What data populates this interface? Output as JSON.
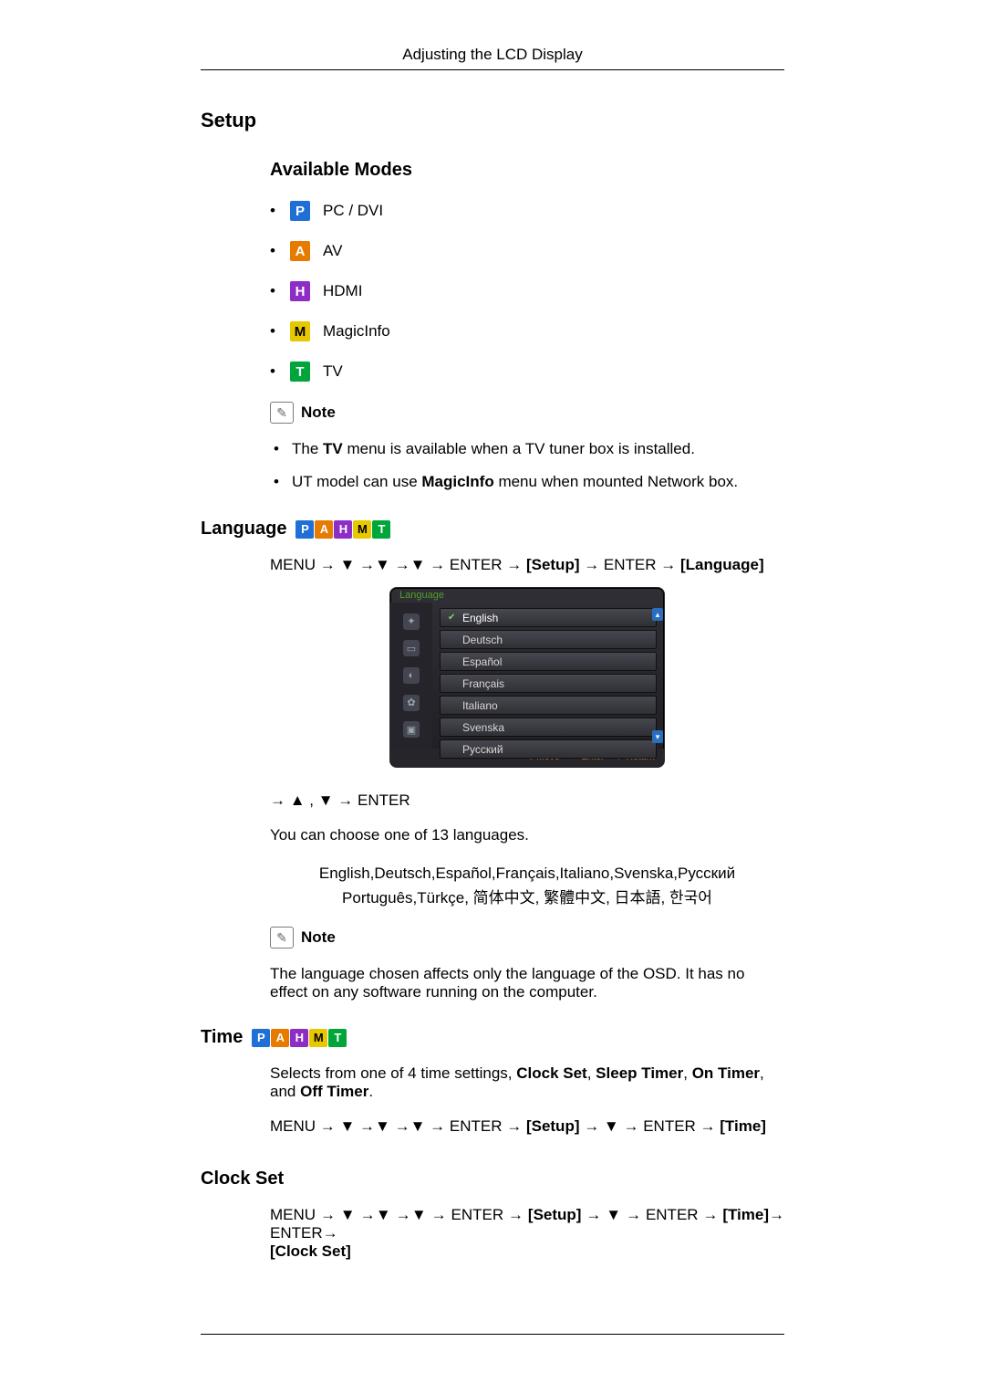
{
  "header": {
    "title": "Adjusting the LCD Display"
  },
  "setup": {
    "heading": "Setup",
    "availableModes": {
      "heading": "Available Modes",
      "items": [
        {
          "chip": "P",
          "chipClass": "chip-p",
          "label": "PC / DVI"
        },
        {
          "chip": "A",
          "chipClass": "chip-a",
          "label": "AV"
        },
        {
          "chip": "H",
          "chipClass": "chip-h",
          "label": "HDMI"
        },
        {
          "chip": "M",
          "chipClass": "chip-m",
          "label": "MagicInfo"
        },
        {
          "chip": "T",
          "chipClass": "chip-t",
          "label": "TV"
        }
      ]
    },
    "note": {
      "label": "Note",
      "items": [
        {
          "before": "The ",
          "bold": "TV",
          "after": " menu is available when a TV tuner box is installed."
        },
        {
          "before": "UT model can use ",
          "bold": "MagicInfo",
          "after": " menu when mounted Network box."
        }
      ]
    }
  },
  "language": {
    "heading": "Language",
    "nav1": {
      "m": "MENU ",
      "a": "→ ▼ →▼ →▼ → ENTER → ",
      "s": "[Setup]",
      "b": " → ENTER → ",
      "t": "[Language]"
    },
    "osd": {
      "title": "Language",
      "items": [
        "English",
        "Deutsch",
        "Español",
        "Français",
        "Italiano",
        "Svenska",
        "Русский"
      ],
      "footer": {
        "move": "Move",
        "enter": "Enter",
        "return": "Return"
      },
      "scroll": {
        "up": "▴",
        "down": "▾"
      }
    },
    "nav2": "→ ▲ , ▼ → ENTER",
    "canChoose": "You can choose one of 13 languages.",
    "list1": "English,Deutsch,Español,Français,Italiano,Svenska,Русский",
    "list2": "Português,Türkçe, 简体中文,  繁體中文, 日本語, 한국어",
    "noteLabel": "Note",
    "noteText": "The language chosen affects only the language of the OSD. It has no effect on any software running on the computer."
  },
  "time": {
    "heading": "Time",
    "intro": {
      "pre": "Selects from one of 4 time settings, ",
      "b1": "Clock Set",
      "c1": ", ",
      "b2": "Sleep Timer",
      "c2": ", ",
      "b3": "On Timer",
      "c3": ", and ",
      "b4": "Off Timer",
      "post": "."
    },
    "nav": {
      "m": "MENU ",
      "a": "→ ▼ →▼ →▼ → ENTER → ",
      "s": "[Setup]",
      "b": " → ▼ → ENTER → ",
      "t": "[Time]"
    }
  },
  "clockSet": {
    "heading": "Clock Set",
    "nav": {
      "m": "MENU ",
      "a": " →  ▼  →▼  →▼  →  ENTER  →  ",
      "s": "[Setup]",
      "b": "  →  ▼  →  ENTER  →  ",
      "t": "[Time]",
      "c": "→  ENTER→ ",
      "u": "[Clock Set]"
    }
  },
  "chips": {
    "P": "P",
    "A": "A",
    "H": "H",
    "M": "M",
    "T": "T"
  }
}
